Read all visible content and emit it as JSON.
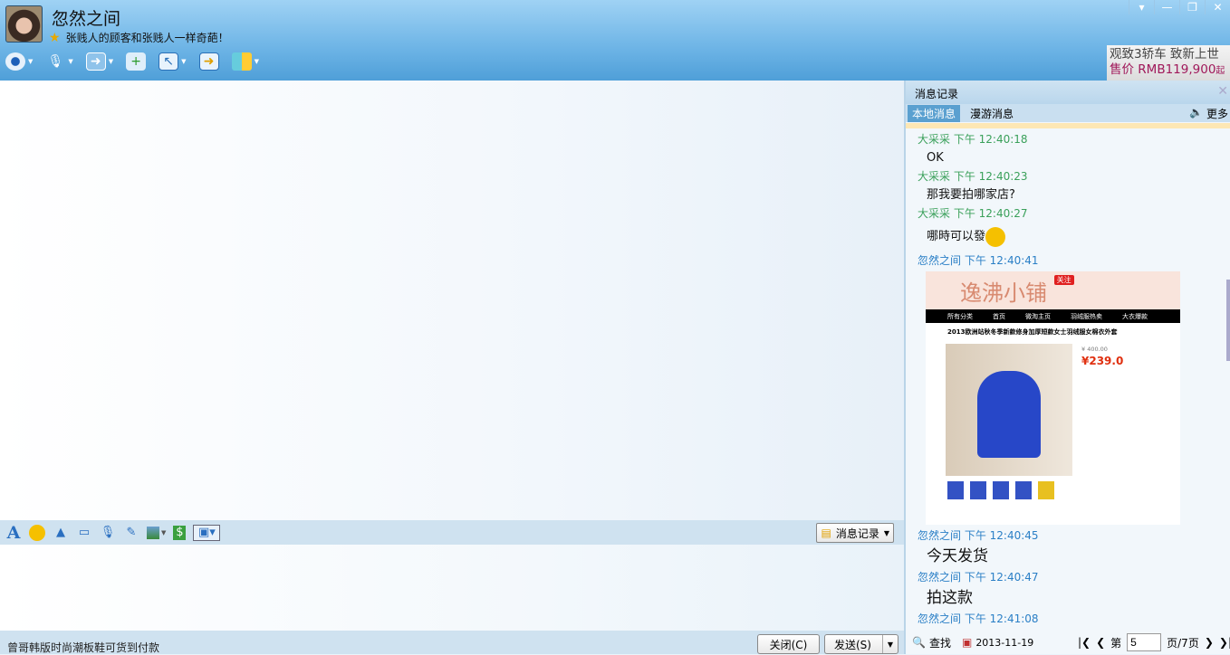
{
  "header": {
    "name": "忽然之间",
    "signature": "张贱人的顾客和张贱人一样奇葩！",
    "tools": [
      "webcam-icon",
      "mic-icon",
      "file-transfer-icon",
      "new-chat-icon",
      "remote-desktop-icon",
      "screen-share-icon",
      "apps-icon"
    ]
  },
  "window": {
    "menu": "▾",
    "minimize": "—",
    "restore": "❐",
    "close": "✕"
  },
  "ad": {
    "line1": "观致3轿车  致新上世",
    "line2": "售价 RMB119,900",
    "suffix": "起"
  },
  "input_toolbar": {
    "icons": [
      "font-icon",
      "emoji-icon",
      "magic-icon",
      "screenshot-frame-icon",
      "voice-icon",
      "note-icon",
      "image-icon",
      "gift-icon",
      "screen-capture-icon"
    ],
    "history_button": "消息记录"
  },
  "footer": {
    "promo": "曾哥韩版时尚潮板鞋可货到付款",
    "close": "关闭(C)",
    "send": "发送(S)"
  },
  "history": {
    "title": "消息记录",
    "tabs": [
      "本地消息",
      "漫游消息"
    ],
    "more": "更多",
    "messages": [
      {
        "sender": "大采采 下午 12:40:18",
        "text": "OK",
        "color": "g"
      },
      {
        "sender": "大采采 下午 12:40:23",
        "text": "那我要拍哪家店?",
        "color": "g"
      },
      {
        "sender": "大采采 下午 12:40:27",
        "text": "哪時可以發",
        "color": "g"
      },
      {
        "sender": "忽然之间 下午 12:40:41",
        "text": "",
        "color": "b"
      },
      {
        "sender": "忽然之间 下午 12:40:45",
        "text": "今天发货",
        "color": "b"
      },
      {
        "sender": "忽然之间 下午 12:40:47",
        "text": "拍这款",
        "color": "b"
      },
      {
        "sender": "忽然之间 下午 12:41:08",
        "text": "",
        "color": "b"
      }
    ],
    "shot": {
      "shop": "逸沸小铺",
      "follow": "关注",
      "nav": [
        "所有分类",
        "首页",
        "微淘主页",
        "羽绒服热卖",
        "大衣爆款"
      ],
      "title": "2013欧洲站秋冬季新款修身加厚短款女士羽绒服女棉衣外套",
      "orig": "¥ 400.00",
      "price": "¥239.0"
    },
    "search": "查找",
    "date": "2013-11-19",
    "page_prefix": "第",
    "page": "5",
    "page_suffix": "页/7页"
  }
}
